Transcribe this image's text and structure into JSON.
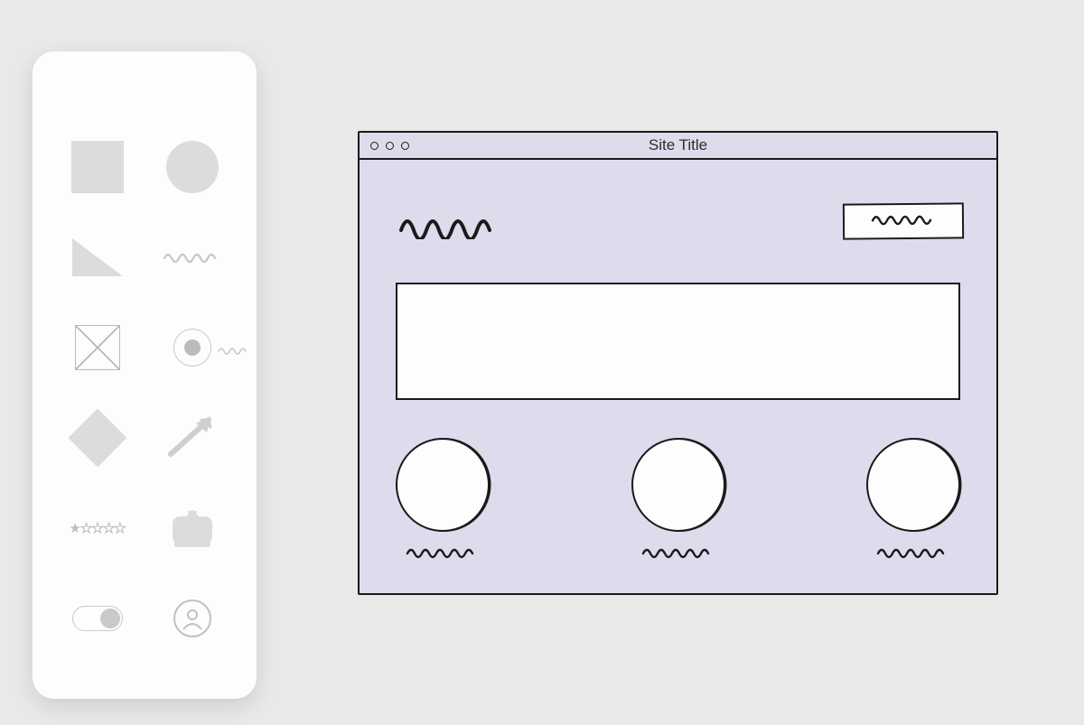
{
  "palette": {
    "shapes": [
      {
        "name": "square-shape"
      },
      {
        "name": "circle-shape"
      },
      {
        "name": "triangle-shape"
      },
      {
        "name": "scribble-shape"
      },
      {
        "name": "image-placeholder-shape"
      },
      {
        "name": "radio-shape"
      },
      {
        "name": "diamond-shape"
      },
      {
        "name": "arrow-shape"
      },
      {
        "name": "star-rating-shape"
      },
      {
        "name": "tag-shape"
      },
      {
        "name": "toggle-shape"
      },
      {
        "name": "avatar-shape"
      }
    ]
  },
  "browser": {
    "title": "Site Title",
    "features": [
      {
        "id": 1
      },
      {
        "id": 2
      },
      {
        "id": 3
      }
    ]
  }
}
